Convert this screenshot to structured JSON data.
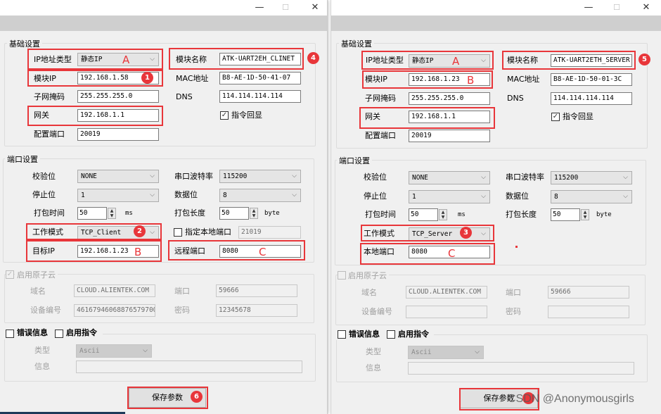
{
  "window_controls": {
    "minimize": "—",
    "maximize": "☐",
    "close": "✕"
  },
  "accent_color": "#e8363a",
  "left": {
    "basic": {
      "legend": "基础设置",
      "ip_type_label": "IP地址类型",
      "ip_type_value": "静态IP",
      "module_name_label": "模块名称",
      "module_name_value": "ATK-UART2EH_CLINET",
      "module_ip_label": "模块IP",
      "module_ip_value": "192.168.1.58",
      "mac_label": "MAC地址",
      "mac_value": "B8-AE-1D-50-41-07",
      "subnet_label": "子网掩码",
      "subnet_value": "255.255.255.0",
      "dns_label": "DNS",
      "dns_value": "114.114.114.114",
      "gateway_label": "网关",
      "gateway_value": "192.168.1.1",
      "echo_label": "指令回显",
      "echo_checked": true,
      "config_port_label": "配置端口",
      "config_port_value": "20019"
    },
    "port": {
      "legend": "端口设置",
      "parity_label": "校验位",
      "parity_value": "NONE",
      "baud_label": "串口波特率",
      "baud_value": "115200",
      "stop_label": "停止位",
      "stop_value": "1",
      "databits_label": "数据位",
      "databits_value": "8",
      "pack_time_label": "打包时间",
      "pack_time_value": "50",
      "pack_time_unit": "ms",
      "pack_len_label": "打包长度",
      "pack_len_value": "50",
      "pack_len_unit": "byte",
      "mode_label": "工作模式",
      "mode_value": "TCP_Client",
      "local_port_label": "指定本地端口",
      "local_port_checked": false,
      "local_port_value": "21019",
      "target_ip_label": "目标IP",
      "target_ip_value": "192.168.1.23",
      "remote_port_label": "远程端口",
      "remote_port_value": "8080"
    },
    "cloud": {
      "legend": "启用原子云",
      "checked": true,
      "domain_label": "域名",
      "domain_value": "CLOUD.ALIENTEK.COM",
      "port_label": "端口",
      "port_value": "59666",
      "device_label": "设备编号",
      "device_value": "46167946068876579700",
      "password_label": "密码",
      "password_value": "12345678"
    },
    "error": {
      "error_label": "错误信息",
      "error_checked": false,
      "cmd_label": "启用指令",
      "cmd_checked": false,
      "type_label": "类型",
      "type_value": "Ascii",
      "info_label": "信息",
      "info_value": ""
    },
    "save_label": "保存参数",
    "annotations": {
      "badge_module_ip": "1",
      "badge_mode": "2",
      "badge_module_name": "4",
      "badge_save": "6",
      "mark_ip_type": "A",
      "mark_target_ip": "B",
      "mark_remote_port": "C"
    }
  },
  "right": {
    "basic": {
      "legend": "基础设置",
      "ip_type_label": "IP地址类型",
      "ip_type_value": "静态IP",
      "module_name_label": "模块名称",
      "module_name_value": "ATK-UART2ETH_SERVER",
      "module_ip_label": "模块IP",
      "module_ip_value": "192.168.1.23",
      "mac_label": "MAC地址",
      "mac_value": "B8-AE-1D-50-01-3C",
      "subnet_label": "子网掩码",
      "subnet_value": "255.255.255.0",
      "dns_label": "DNS",
      "dns_value": "114.114.114.114",
      "gateway_label": "网关",
      "gateway_value": "192.168.1.1",
      "echo_label": "指令回显",
      "echo_checked": true,
      "config_port_label": "配置端口",
      "config_port_value": "20019"
    },
    "port": {
      "legend": "端口设置",
      "parity_label": "校验位",
      "parity_value": "NONE",
      "baud_label": "串口波特率",
      "baud_value": "115200",
      "stop_label": "停止位",
      "stop_value": "1",
      "databits_label": "数据位",
      "databits_value": "8",
      "pack_time_label": "打包时间",
      "pack_time_value": "50",
      "pack_time_unit": "ms",
      "pack_len_label": "打包长度",
      "pack_len_value": "50",
      "pack_len_unit": "byte",
      "mode_label": "工作模式",
      "mode_value": "TCP_Server",
      "local_port_label": "本地端口",
      "local_port_value": "8080"
    },
    "cloud": {
      "legend": "启用原子云",
      "checked": false,
      "domain_label": "域名",
      "domain_value": "CLOUD.ALIENTEK.COM",
      "port_label": "端口",
      "port_value": "59666",
      "device_label": "设备编号",
      "device_value": "",
      "password_label": "密码",
      "password_value": ""
    },
    "error": {
      "error_label": "错误信息",
      "error_checked": false,
      "cmd_label": "启用指令",
      "cmd_checked": false,
      "type_label": "类型",
      "type_value": "Ascii",
      "info_label": "信息",
      "info_value": ""
    },
    "save_label": "保存参数",
    "annotations": {
      "badge_mode": "3",
      "badge_module_name": "5",
      "mark_ip_type": "A",
      "mark_module_ip": "B",
      "mark_local_port": "C"
    }
  },
  "watermark": "CSDN @Anonymousgirls"
}
